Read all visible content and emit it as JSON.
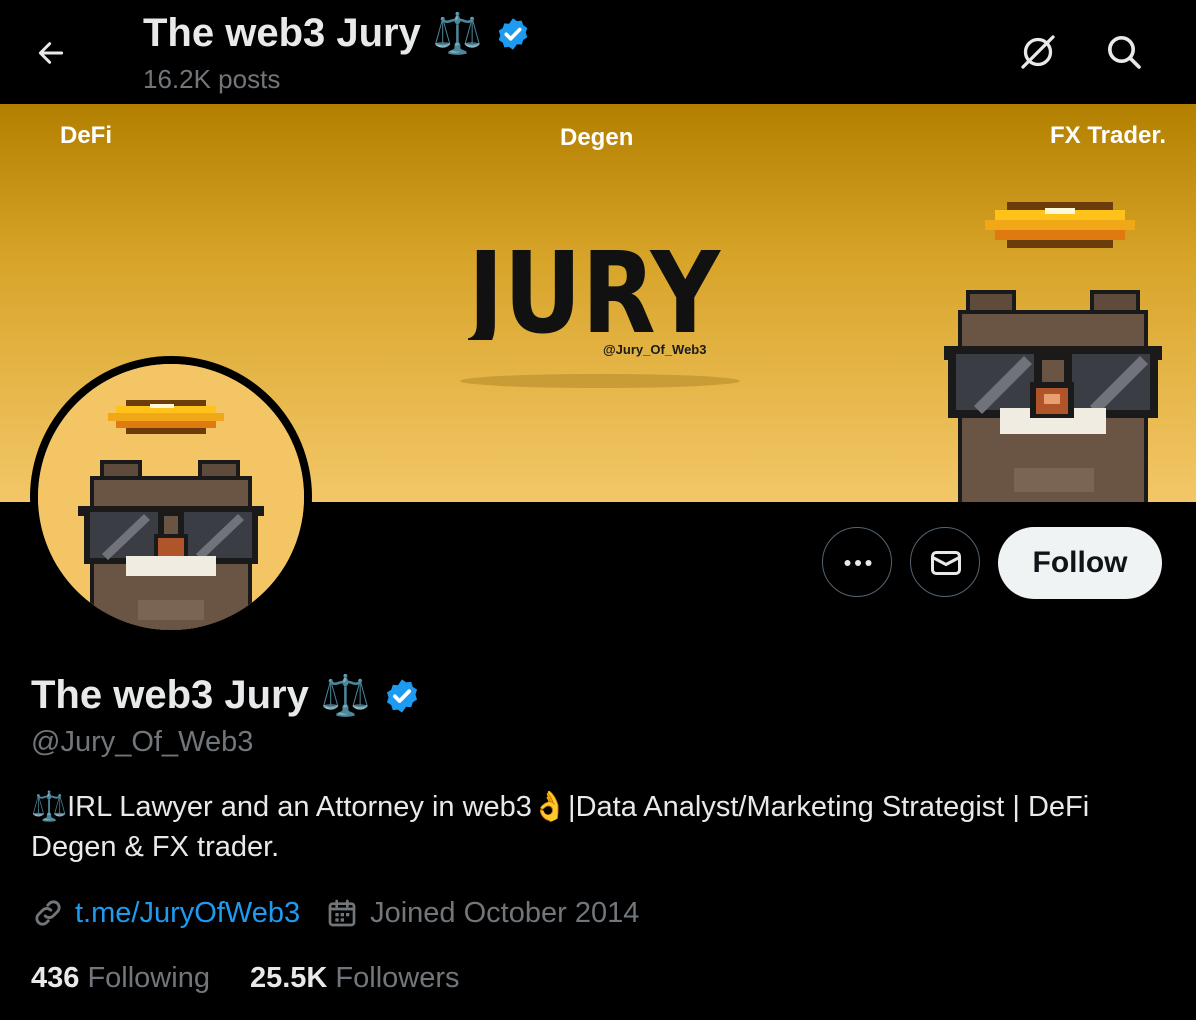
{
  "header": {
    "title": "The web3 Jury",
    "title_emoji": "⚖️",
    "posts": "16.2K posts"
  },
  "banner": {
    "left_text": "DeFi",
    "center_text": "Degen",
    "right_text": "FX Trader.",
    "logo_text": "JURY",
    "logo_handle": "@Jury_Of_Web3"
  },
  "actions": {
    "follow_label": "Follow"
  },
  "profile": {
    "name": "The web3 Jury",
    "name_emoji": "⚖️",
    "handle": "@Jury_Of_Web3",
    "bio": "⚖️IRL Lawyer and an Attorney in web3👌|Data Analyst/Marketing Strategist | DeFi Degen & FX trader.",
    "link": "t.me/JuryOfWeb3",
    "joined": "Joined October 2014"
  },
  "stats": {
    "following_count": "436",
    "following_label": "Following",
    "followers_count": "25.5K",
    "followers_label": "Followers"
  },
  "icons": [
    "back-arrow-icon",
    "grok-icon",
    "search-icon",
    "more-icon",
    "message-icon",
    "verified-badge-icon",
    "link-icon",
    "calendar-icon"
  ],
  "colors": {
    "background": "#000000",
    "text_primary": "#e7e9ea",
    "text_secondary": "#71767b",
    "link": "#1d9bf0",
    "verified": "#1d9bf0",
    "follow_bg": "#eff3f4"
  }
}
